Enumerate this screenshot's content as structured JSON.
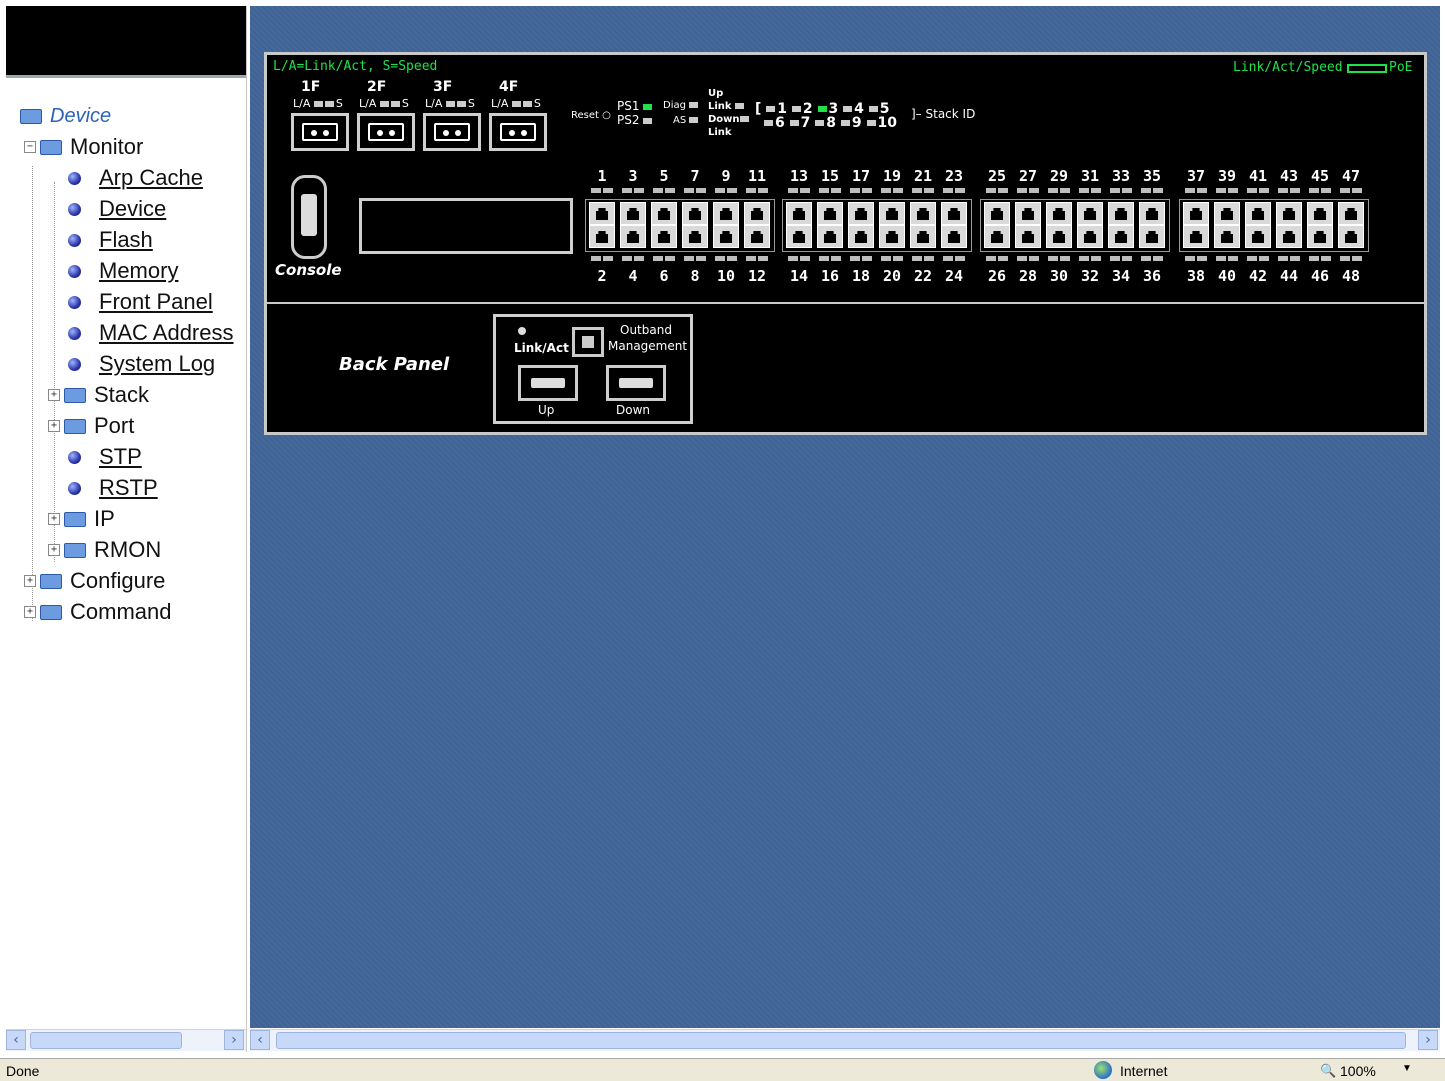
{
  "tree": {
    "device": "Device",
    "monitor": "Monitor",
    "monitor_children": [
      "Arp Cache",
      "Device",
      "Flash",
      "Memory",
      "Front Panel",
      "MAC Address",
      "System Log"
    ],
    "stack": "Stack",
    "port": "Port",
    "stp": "STP",
    "rstp": "RSTP",
    "ip": "IP",
    "rmon": "RMON",
    "configure": "Configure",
    "command": "Command"
  },
  "front_panel": {
    "legend_left": "L/A=Link/Act, S=Speed",
    "legend_right": "Link/Act/Speed",
    "legend_poe": "PoE",
    "sfp_labels": [
      "1F",
      "2F",
      "3F",
      "4F"
    ],
    "sfp_sub": "L/A",
    "sfp_s": "S",
    "reset": "Reset",
    "ps1": "PS1",
    "ps2": "PS2",
    "diag": "Diag",
    "as": "AS",
    "up": "Up",
    "link": "Link",
    "down": "Down",
    "link2": "Link",
    "stack_ids_top": [
      "1",
      "2",
      "3",
      "4",
      "5"
    ],
    "stack_ids_bottom": [
      "6",
      "7",
      "8",
      "9",
      "10"
    ],
    "stack_id_label": "Stack ID",
    "console": "Console",
    "top_ports": [
      "1",
      "3",
      "5",
      "7",
      "9",
      "11",
      "13",
      "15",
      "17",
      "19",
      "21",
      "23",
      "25",
      "27",
      "29",
      "31",
      "33",
      "35",
      "37",
      "39",
      "41",
      "43",
      "45",
      "47"
    ],
    "bottom_ports": [
      "2",
      "4",
      "6",
      "8",
      "10",
      "12",
      "14",
      "16",
      "18",
      "20",
      "22",
      "24",
      "26",
      "28",
      "30",
      "32",
      "34",
      "36",
      "38",
      "40",
      "42",
      "44",
      "46",
      "48"
    ]
  },
  "back_panel": {
    "title": "Back Panel",
    "link_act": "Link/Act",
    "outband": "Outband",
    "management": "Management",
    "up": "Up",
    "down": "Down"
  },
  "status": {
    "left": "Done",
    "zone": "Internet",
    "zoom": "100%"
  },
  "colors": {
    "panel_bg": "#3f6395",
    "led_green": "#1fe24a"
  }
}
